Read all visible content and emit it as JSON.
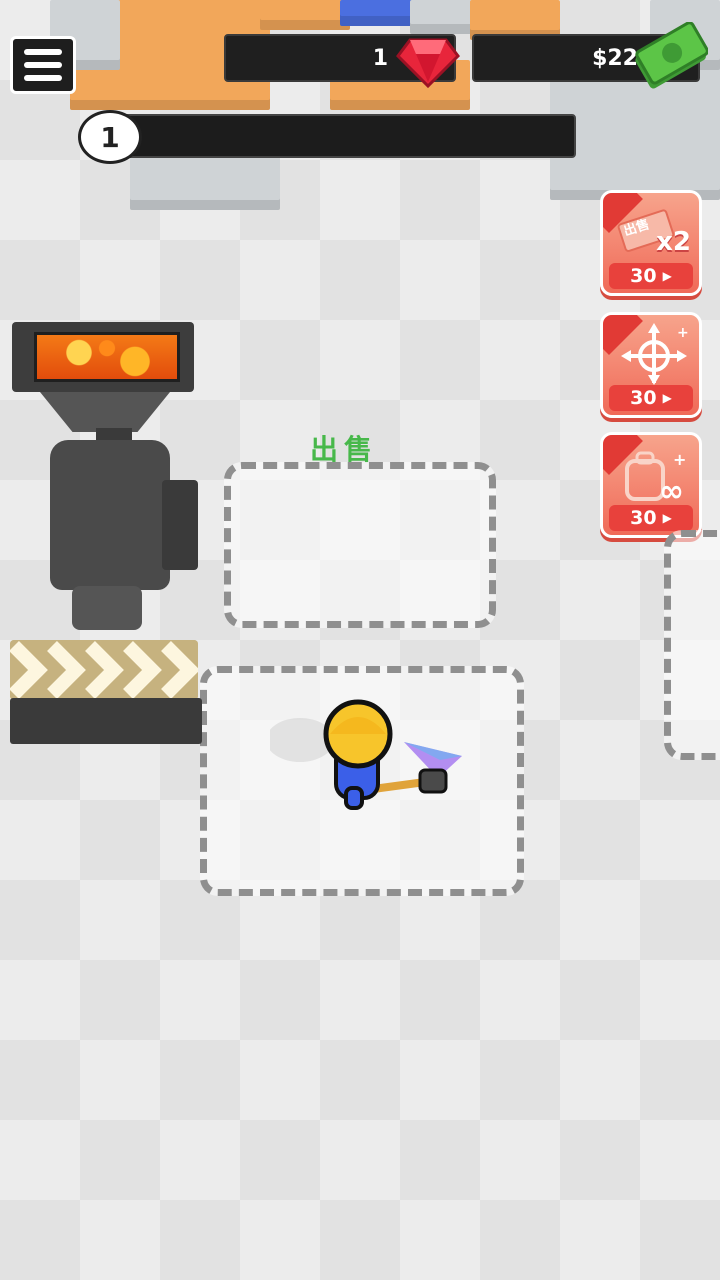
{
  "hud": {
    "gems": "1",
    "cash": "$22",
    "level": "1",
    "level_progress": 0.0
  },
  "boosts": [
    {
      "name": "sell-x2",
      "badge": "出售",
      "multiplier": "x2",
      "price": "30"
    },
    {
      "name": "move-speed",
      "price": "30"
    },
    {
      "name": "capacity",
      "price": "30"
    }
  ],
  "zones": {
    "sell_label": "出售"
  },
  "colors": {
    "accent_green": "#47b84a",
    "boost_red": "#f06a58",
    "gem_red": "#e8253b",
    "cash_green": "#5cc547"
  }
}
